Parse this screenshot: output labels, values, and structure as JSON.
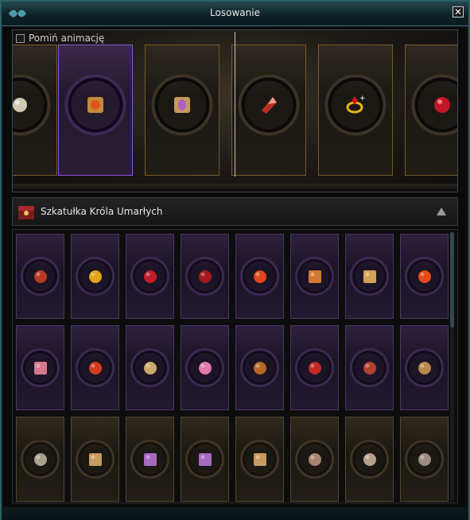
{
  "window": {
    "title": "Losowanie"
  },
  "roll": {
    "skip_label": "Pomiń animację",
    "cards": [
      {
        "state": "normal",
        "icon": "pearl-icon"
      },
      {
        "state": "selected",
        "icon": "scroll-orange-icon"
      },
      {
        "state": "normal",
        "icon": "scroll-purple-icon"
      },
      {
        "state": "normal",
        "icon": "red-shard-icon"
      },
      {
        "state": "normal",
        "icon": "gold-ring-icon"
      },
      {
        "state": "normal",
        "icon": "red-orb-icon"
      }
    ]
  },
  "box": {
    "title": "Szkatułka Króla Umarłych"
  },
  "grid": {
    "rows": [
      [
        "armor-icon",
        "gold-gem-icon",
        "red-crystal-icon",
        "red-gem-icon",
        "fire-shard-icon",
        "scroll-orange-icon",
        "scroll-gold-icon",
        "fire-orb-icon"
      ],
      [
        "scroll-pink-icon",
        "red-potion-icon",
        "crossed-swords-icon",
        "pink-ring-icon",
        "horn-icon",
        "red-gloves-icon",
        "chest-icon",
        "treasure-icon"
      ],
      [
        "skull-icon",
        "scroll-tan-icon",
        "scroll-purple-icon",
        "scroll-purple-icon",
        "scroll-tan-icon",
        "bronze-coin-icon",
        "spiky-gem-icon",
        "stone-icon"
      ]
    ],
    "row_styles": [
      "purple",
      "purple",
      "gold"
    ]
  },
  "colors": {
    "accent": "#2c5f66",
    "purple": "#8e55d8",
    "gold": "#7a5a24"
  }
}
